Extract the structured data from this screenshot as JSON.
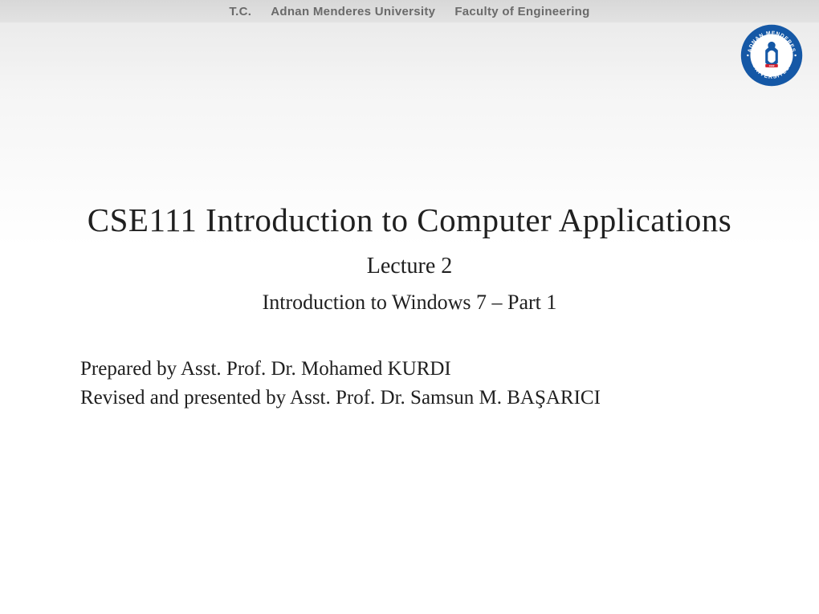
{
  "header": {
    "tc": "T.C.",
    "university": "Adnan Menderes University",
    "faculty": "Faculty of Engineering"
  },
  "logo": {
    "outer_text_top": "ADNAN MENDERES",
    "outer_text_bottom": "ÜNİVERSİTESİ",
    "year": "1992",
    "ring_color": "#1558a6",
    "inner_color": "#ffffff",
    "accent_color": "#d01f2e"
  },
  "content": {
    "course_title": "CSE111  Introduction to Computer Applications",
    "lecture_number": "Lecture 2",
    "lecture_topic": "Introduction to Windows 7 – Part 1",
    "prepared_by": "Prepared by Asst. Prof. Dr. Mohamed KURDI",
    "presented_by": "Revised and presented by Asst. Prof. Dr. Samsun M. BAŞARICI"
  }
}
